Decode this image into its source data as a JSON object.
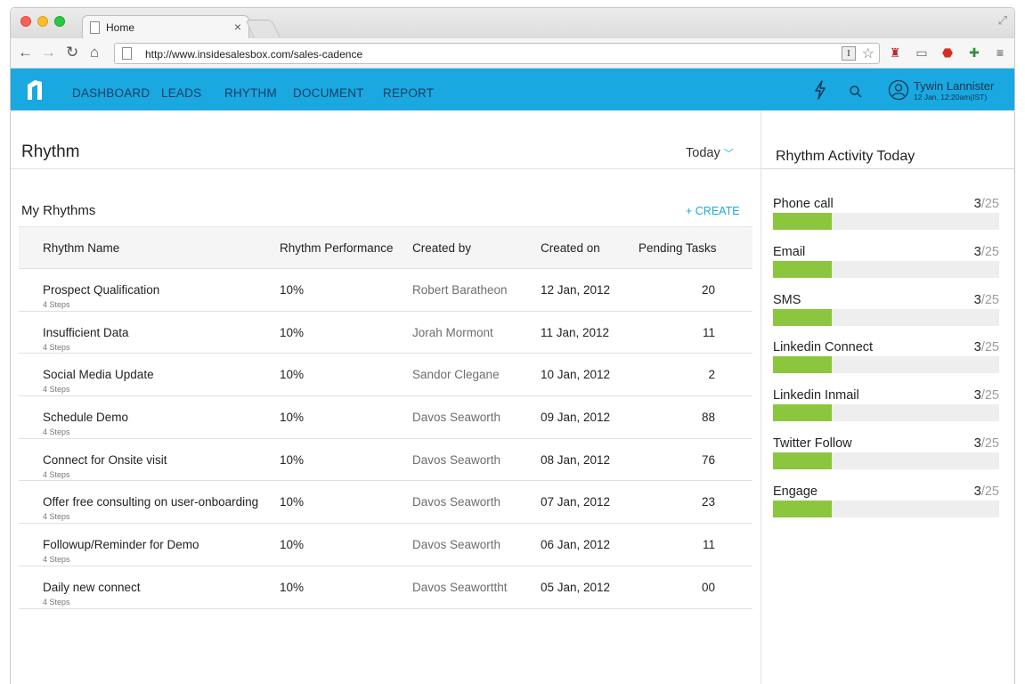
{
  "browser": {
    "tab_title": "Home",
    "tab_close": "×",
    "url": "http://www.insidesalesbox.com/sales-cadence",
    "url_ibox": "I"
  },
  "nav": {
    "items": [
      {
        "label": "DASHBOARD"
      },
      {
        "label": "LEADS"
      },
      {
        "label": "RHYTHM"
      },
      {
        "label": "DOCUMENT"
      },
      {
        "label": "REPORT"
      }
    ],
    "user_name": "Tywin Lannister",
    "user_time": "12 Jan, 12:20am(IST)"
  },
  "main": {
    "title": "Rhythm",
    "filter": "Today",
    "section_title": "My Rhythms",
    "create_label": "+ CREATE",
    "columns": [
      "Rhythm Name",
      "Rhythm Performance",
      "Created by",
      "Created on",
      "Pending Tasks"
    ],
    "rows": [
      {
        "name": "Prospect Qualification",
        "steps": "4 Steps",
        "performance": "10%",
        "created_by": "Robert Baratheon",
        "created_on": "12 Jan, 2012",
        "pending": "20"
      },
      {
        "name": "Insufficient Data",
        "steps": "4 Steps",
        "performance": "10%",
        "created_by": "Jorah Mormont",
        "created_on": "11 Jan, 2012",
        "pending": "11"
      },
      {
        "name": "Social Media Update",
        "steps": "4 Steps",
        "performance": "10%",
        "created_by": "Sandor Clegane",
        "created_on": "10 Jan, 2012",
        "pending": "2"
      },
      {
        "name": "Schedule Demo",
        "steps": "4 Steps",
        "performance": "10%",
        "created_by": "Davos Seaworth",
        "created_on": "09 Jan, 2012",
        "pending": "88"
      },
      {
        "name": "Connect for Onsite visit",
        "steps": "4 Steps",
        "performance": "10%",
        "created_by": "Davos Seaworth",
        "created_on": "08 Jan, 2012",
        "pending": "76"
      },
      {
        "name": "Offer free consulting on user-onboarding",
        "steps": "4 Steps",
        "performance": "10%",
        "created_by": "Davos Seaworth",
        "created_on": "07 Jan, 2012",
        "pending": "23"
      },
      {
        "name": "Followup/Reminder for Demo",
        "steps": "4 Steps",
        "performance": "10%",
        "created_by": "Davos Seaworth",
        "created_on": "06 Jan, 2012",
        "pending": "11"
      },
      {
        "name": "Daily new connect",
        "steps": "4 Steps",
        "performance": "10%",
        "created_by": "Davos Seaworttht",
        "created_on": "05 Jan, 2012",
        "pending": "00"
      }
    ]
  },
  "side": {
    "title": "Rhythm Activity Today",
    "activities": [
      {
        "label": "Phone call",
        "done": "3",
        "total": "/25",
        "progress": 0.12
      },
      {
        "label": "Email",
        "done": "3",
        "total": "/25",
        "progress": 0.12
      },
      {
        "label": "SMS",
        "done": "3",
        "total": "/25",
        "progress": 0.12
      },
      {
        "label": "Linkedin Connect",
        "done": "3",
        "total": "/25",
        "progress": 0.12
      },
      {
        "label": "Linkedin Inmail",
        "done": "3",
        "total": "/25",
        "progress": 0.12
      },
      {
        "label": "Twitter Follow",
        "done": "3",
        "total": "/25",
        "progress": 0.12
      },
      {
        "label": "Engage",
        "done": "3",
        "total": "/25",
        "progress": 0.12
      }
    ]
  },
  "colors": {
    "brand": "#19a8e0",
    "progress": "#8cc63e",
    "track": "#eeeeee"
  }
}
